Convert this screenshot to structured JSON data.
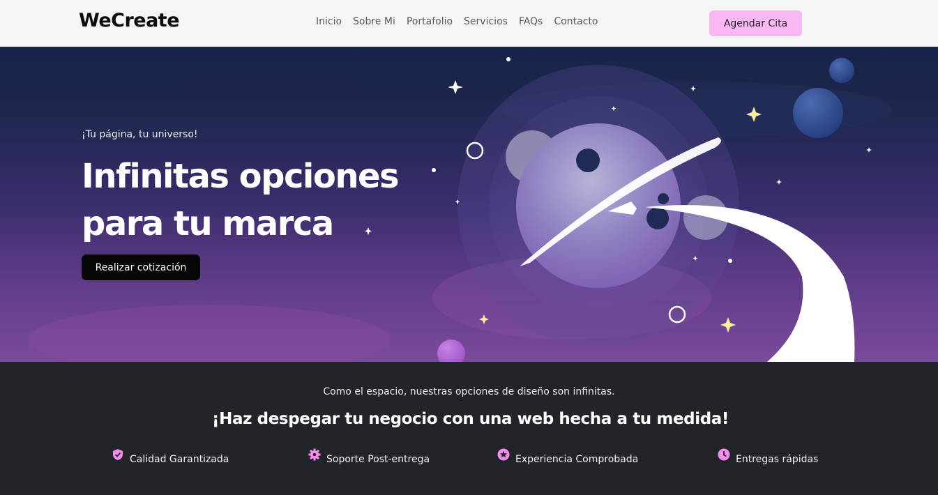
{
  "navbar": {
    "brand": "WeCreate",
    "links": [
      "Inicio",
      "Sobre Mi",
      "Portafolio",
      "Servicios",
      "FAQs",
      "Contacto"
    ],
    "cta": "Agendar Cita"
  },
  "hero": {
    "kicker": "¡Tu página, tu universo!",
    "title_line1": "Infinitas opciones",
    "title_line2": "para tu marca",
    "button": "Realizar cotización"
  },
  "features": {
    "subtitle": "Como el espacio, nuestras opciones de diseño son infinitas.",
    "title": "¡Haz despegar tu negocio con una web hecha a tu medida!",
    "items": [
      {
        "label": "Calidad Garantizada",
        "icon": "shield-check-icon"
      },
      {
        "label": "Soporte Post-entrega",
        "icon": "gear-icon"
      },
      {
        "label": "Experiencia Comprobada",
        "icon": "star-badge-icon"
      },
      {
        "label": "Entregas rápidas",
        "icon": "clock-icon"
      }
    ]
  },
  "colors": {
    "accent": "#f9b8f3",
    "dark": "#212529",
    "icon_pink": "#f58bea"
  }
}
